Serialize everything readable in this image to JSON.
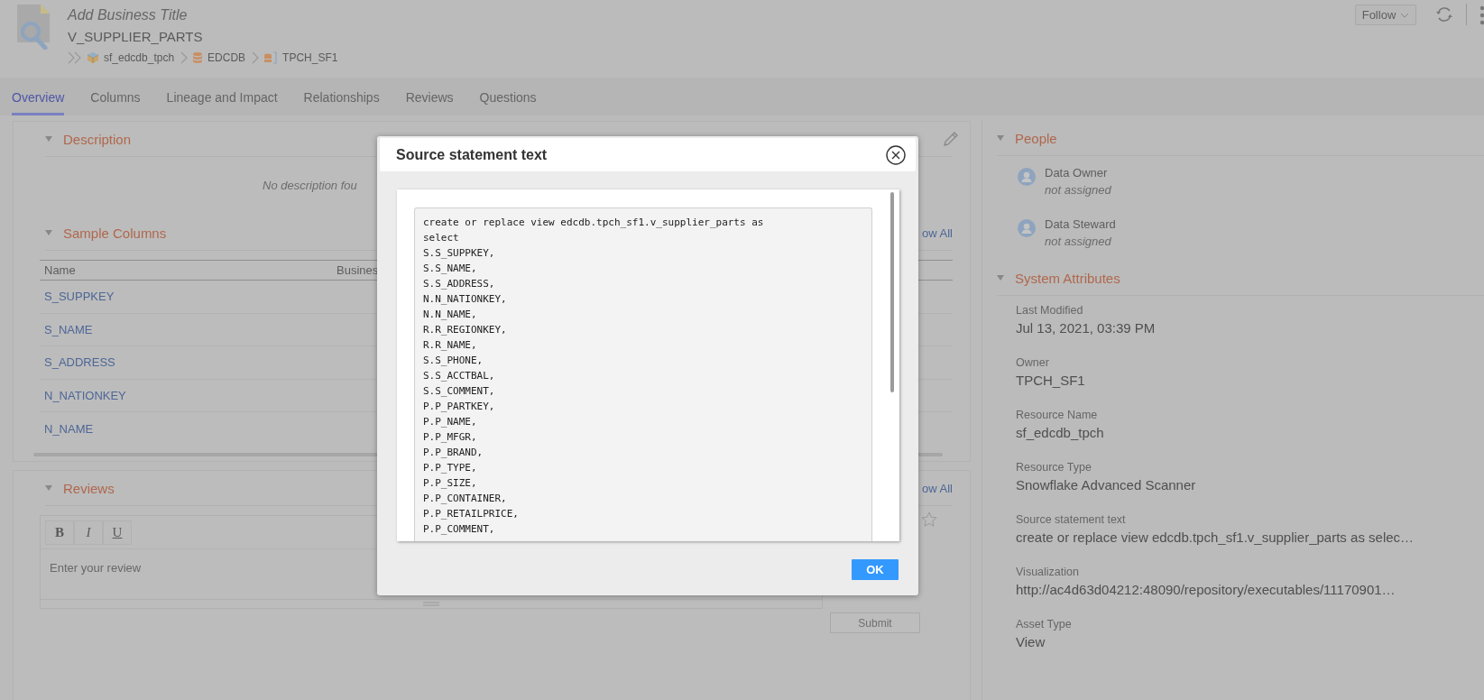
{
  "header": {
    "business_title_placeholder": "Add Business Title",
    "name": "V_SUPPLIER_PARTS",
    "follow_button": "Follow",
    "breadcrumb": [
      {
        "kind": "resource",
        "label": "sf_edcdb_tpch"
      },
      {
        "kind": "database",
        "label": "EDCDB"
      },
      {
        "kind": "schema",
        "label": "TPCH_SF1"
      }
    ]
  },
  "tabs": [
    {
      "label": "Overview",
      "selected": true
    },
    {
      "label": "Columns",
      "selected": false
    },
    {
      "label": "Lineage and Impact",
      "selected": false
    },
    {
      "label": "Relationships",
      "selected": false
    },
    {
      "label": "Reviews",
      "selected": false
    },
    {
      "label": "Questions",
      "selected": false
    }
  ],
  "description": {
    "title": "Description",
    "empty_text": "No description fou"
  },
  "sample_columns": {
    "title": "Sample Columns",
    "show_all": "ow All",
    "columns": [
      "Name",
      "Busines"
    ],
    "rows": [
      "S_SUPPKEY",
      "S_NAME",
      "S_ADDRESS",
      "N_NATIONKEY",
      "N_NAME"
    ]
  },
  "reviews": {
    "title": "Reviews",
    "show_all": "ow All",
    "format_buttons": [
      {
        "kind": "bold",
        "label": "B"
      },
      {
        "kind": "italic",
        "label": "I"
      },
      {
        "kind": "underline",
        "label": "U"
      }
    ],
    "placeholder": "Enter your review",
    "submit": {
      "label": "Submit",
      "disabled": true
    }
  },
  "people": {
    "title": "People",
    "roles": [
      {
        "role": "Data Owner",
        "value": "not assigned"
      },
      {
        "role": "Data Steward",
        "value": "not assigned"
      }
    ]
  },
  "system_attributes": {
    "title": "System Attributes",
    "items": [
      {
        "label": "Last Modified",
        "value": "Jul 13, 2021, 03:39 PM"
      },
      {
        "label": "Owner",
        "value": "TPCH_SF1"
      },
      {
        "label": "Resource Name",
        "value": "sf_edcdb_tpch"
      },
      {
        "label": "Resource Type",
        "value": "Snowflake Advanced Scanner"
      },
      {
        "label": "Source statement text",
        "value": "create or replace view edcdb.tpch_sf1.v_supplier_parts as selec…"
      },
      {
        "label": "Visualization",
        "value": "http://ac4d63d04212:48090/repository/executables/11170901…"
      },
      {
        "label": "Asset Type",
        "value": "View"
      }
    ]
  },
  "dialog": {
    "title": "Source statement text",
    "ok": "OK",
    "code": "create or replace view edcdb.tpch_sf1.v_supplier_parts as\nselect\nS.S_SUPPKEY,\nS.S_NAME,\nS.S_ADDRESS,\nN.N_NATIONKEY,\nN.N_NAME,\nR.R_REGIONKEY,\nR.R_NAME,\nS.S_PHONE,\nS.S_ACCTBAL,\nS.S_COMMENT,\nP.P_PARTKEY,\nP.P_NAME,\nP.P_MFGR,\nP.P_BRAND,\nP.P_TYPE,\nP.P_SIZE,\nP.P_CONTAINER,\nP.P_RETAILPRICE,\nP.P_COMMENT,"
  }
}
